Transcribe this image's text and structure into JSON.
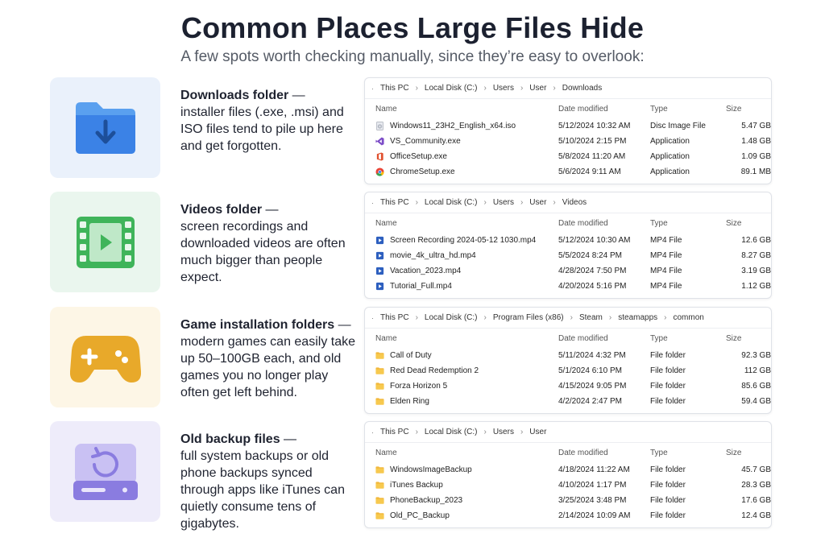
{
  "title": "Common Places Large Files Hide",
  "subtitle": "A few spots worth checking manually, since they’re easy to overlook:",
  "columns": {
    "name": "Name",
    "date": "Date modified",
    "type": "Type",
    "size": "Size"
  },
  "sections": [
    {
      "heading": "Downloads folder",
      "heading_suffix": " —",
      "body": "installer files (.exe, .msi) and ISO files tend to pile up here and get forgotten.",
      "icon": "download-folder-icon",
      "accent": "#3b82e6",
      "breadcrumb": [
        "This PC",
        "Local Disk (C:)",
        "Users",
        "User",
        "Downloads"
      ],
      "files": [
        {
          "name": "Windows11_23H2_English_x64.iso",
          "date": "5/12/2024 10:32 AM",
          "type": "Disc Image File",
          "size": "5.47 GB",
          "icon": "disc-image-icon"
        },
        {
          "name": "VS_Community.exe",
          "date": "5/10/2024 2:15 PM",
          "type": "Application",
          "size": "1.48 GB",
          "icon": "visual-studio-icon"
        },
        {
          "name": "OfficeSetup.exe",
          "date": "5/8/2024 11:20 AM",
          "type": "Application",
          "size": "1.09 GB",
          "icon": "office-icon"
        },
        {
          "name": "ChromeSetup.exe",
          "date": "5/6/2024 9:11 AM",
          "type": "Application",
          "size": "89.1 MB",
          "icon": "chrome-icon"
        }
      ]
    },
    {
      "heading": "Videos folder",
      "heading_suffix": " —",
      "body": "screen recordings and downloaded videos are often much bigger than people expect.",
      "icon": "video-film-icon",
      "accent": "#3fb45a",
      "breadcrumb": [
        "This PC",
        "Local Disk (C:)",
        "Users",
        "User",
        "Videos"
      ],
      "files": [
        {
          "name": "Screen Recording 2024-05-12 1030.mp4",
          "date": "5/12/2024 10:30 AM",
          "type": "MP4 File",
          "size": "12.6 GB",
          "icon": "video-file-icon"
        },
        {
          "name": "movie_4k_ultra_hd.mp4",
          "date": "5/5/2024 8:24 PM",
          "type": "MP4 File",
          "size": "8.27 GB",
          "icon": "video-file-icon"
        },
        {
          "name": "Vacation_2023.mp4",
          "date": "4/28/2024 7:50 PM",
          "type": "MP4 File",
          "size": "3.19 GB",
          "icon": "video-file-icon"
        },
        {
          "name": "Tutorial_Full.mp4",
          "date": "4/20/2024 5:16 PM",
          "type": "MP4 File",
          "size": "1.12 GB",
          "icon": "video-file-icon"
        }
      ]
    },
    {
      "heading": "Game installation folders",
      "heading_suffix": " —",
      "body": "modern games can easily take up 50–100GB each, and old games you no longer play often get left behind.",
      "icon": "game-controller-icon",
      "accent": "#e8a92a",
      "breadcrumb": [
        "This PC",
        "Local Disk (C:)",
        "Program Files (x86)",
        "Steam",
        "steamapps",
        "common"
      ],
      "files": [
        {
          "name": "Call of Duty",
          "date": "5/11/2024 4:32 PM",
          "type": "File folder",
          "size": "92.3 GB",
          "icon": "folder-icon"
        },
        {
          "name": "Red Dead Redemption 2",
          "date": "5/1/2024 6:10 PM",
          "type": "File folder",
          "size": "112 GB",
          "icon": "folder-icon"
        },
        {
          "name": "Forza Horizon 5",
          "date": "4/15/2024 9:05 PM",
          "type": "File folder",
          "size": "85.6 GB",
          "icon": "folder-icon"
        },
        {
          "name": "Elden Ring",
          "date": "4/2/2024 2:47 PM",
          "type": "File folder",
          "size": "59.4 GB",
          "icon": "folder-icon"
        }
      ]
    },
    {
      "heading": "Old backup files",
      "heading_suffix": " —",
      "body": "full system backups or old phone backups synced through apps like iTunes can quietly consume tens of gigabytes.",
      "icon": "backup-drive-icon",
      "accent": "#8a7ce0",
      "breadcrumb": [
        "This PC",
        "Local Disk (C:)",
        "Users",
        "User"
      ],
      "files": [
        {
          "name": "WindowsImageBackup",
          "date": "4/18/2024 11:22 AM",
          "type": "File folder",
          "size": "45.7 GB",
          "icon": "folder-icon"
        },
        {
          "name": "iTunes Backup",
          "date": "4/10/2024 1:17 PM",
          "type": "File folder",
          "size": "28.3 GB",
          "icon": "folder-icon"
        },
        {
          "name": "PhoneBackup_2023",
          "date": "3/25/2024 3:48 PM",
          "type": "File folder",
          "size": "17.6 GB",
          "icon": "folder-icon"
        },
        {
          "name": "Old_PC_Backup",
          "date": "2/14/2024 10:09 AM",
          "type": "File folder",
          "size": "12.4 GB",
          "icon": "folder-icon"
        }
      ]
    }
  ]
}
